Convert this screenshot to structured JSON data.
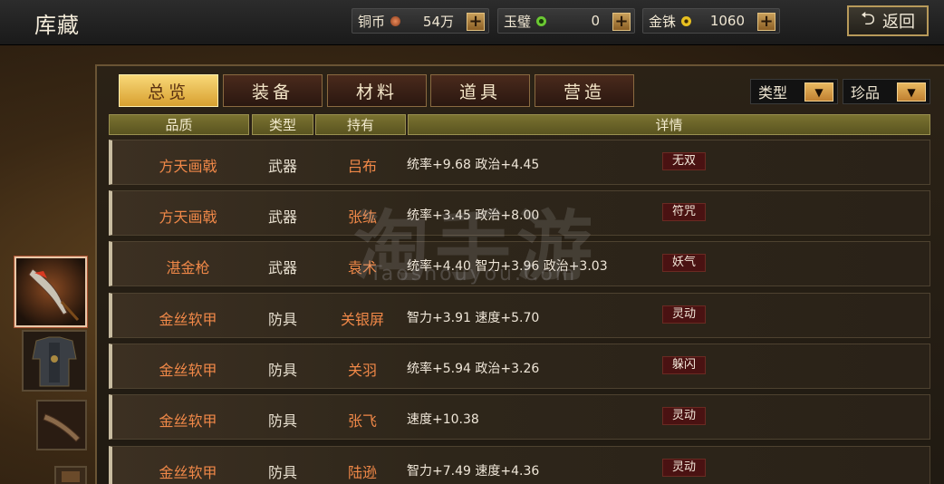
{
  "header": {
    "title": "库藏",
    "back_label": "返回"
  },
  "currencies": [
    {
      "name": "铜币",
      "value": "54万",
      "coin_color": "#c8653a"
    },
    {
      "name": "玉璧",
      "value": "0",
      "coin_color": "#6ac832"
    },
    {
      "name": "金铢",
      "value": "1060",
      "coin_color": "#e8c020"
    }
  ],
  "tabs": [
    {
      "label": "总览",
      "active": true
    },
    {
      "label": "装备",
      "active": false
    },
    {
      "label": "材料",
      "active": false
    },
    {
      "label": "道具",
      "active": false
    },
    {
      "label": "营造",
      "active": false
    }
  ],
  "filters": [
    {
      "label": "类型"
    },
    {
      "label": "珍品"
    }
  ],
  "columns": [
    "品质",
    "类型",
    "持有",
    "详情"
  ],
  "rows": [
    {
      "quality": "方天画戟",
      "type": "武器",
      "owner": "吕布",
      "stats": "统率+9.68 政治+4.45",
      "skill": "无双"
    },
    {
      "quality": "方天画戟",
      "type": "武器",
      "owner": "张纮",
      "stats": "统率+3.45 政治+8.00",
      "skill": "符咒"
    },
    {
      "quality": "湛金枪",
      "type": "武器",
      "owner": "袁术",
      "stats": "统率+4.40 智力+3.96 政治+3.03",
      "skill": "妖气"
    },
    {
      "quality": "金丝软甲",
      "type": "防具",
      "owner": "关银屏",
      "stats": "智力+3.91 速度+5.70",
      "skill": "灵动"
    },
    {
      "quality": "金丝软甲",
      "type": "防具",
      "owner": "关羽",
      "stats": "统率+5.94 政治+3.26",
      "skill": "躲闪"
    },
    {
      "quality": "金丝软甲",
      "type": "防具",
      "owner": "张飞",
      "stats": "速度+10.38",
      "skill": "灵动"
    },
    {
      "quality": "金丝软甲",
      "type": "防具",
      "owner": "陆逊",
      "stats": "智力+7.49 速度+4.36",
      "skill": "灵动"
    }
  ],
  "thumbnails": [
    {
      "icon": "halberd-icon",
      "selected": true
    },
    {
      "icon": "armor-icon",
      "selected": false
    },
    {
      "icon": "weapon-icon",
      "selected": false
    },
    {
      "icon": "item-icon",
      "selected": false
    }
  ],
  "watermark": {
    "main": "淘手游",
    "sub": "Taoshouyou.Com"
  }
}
